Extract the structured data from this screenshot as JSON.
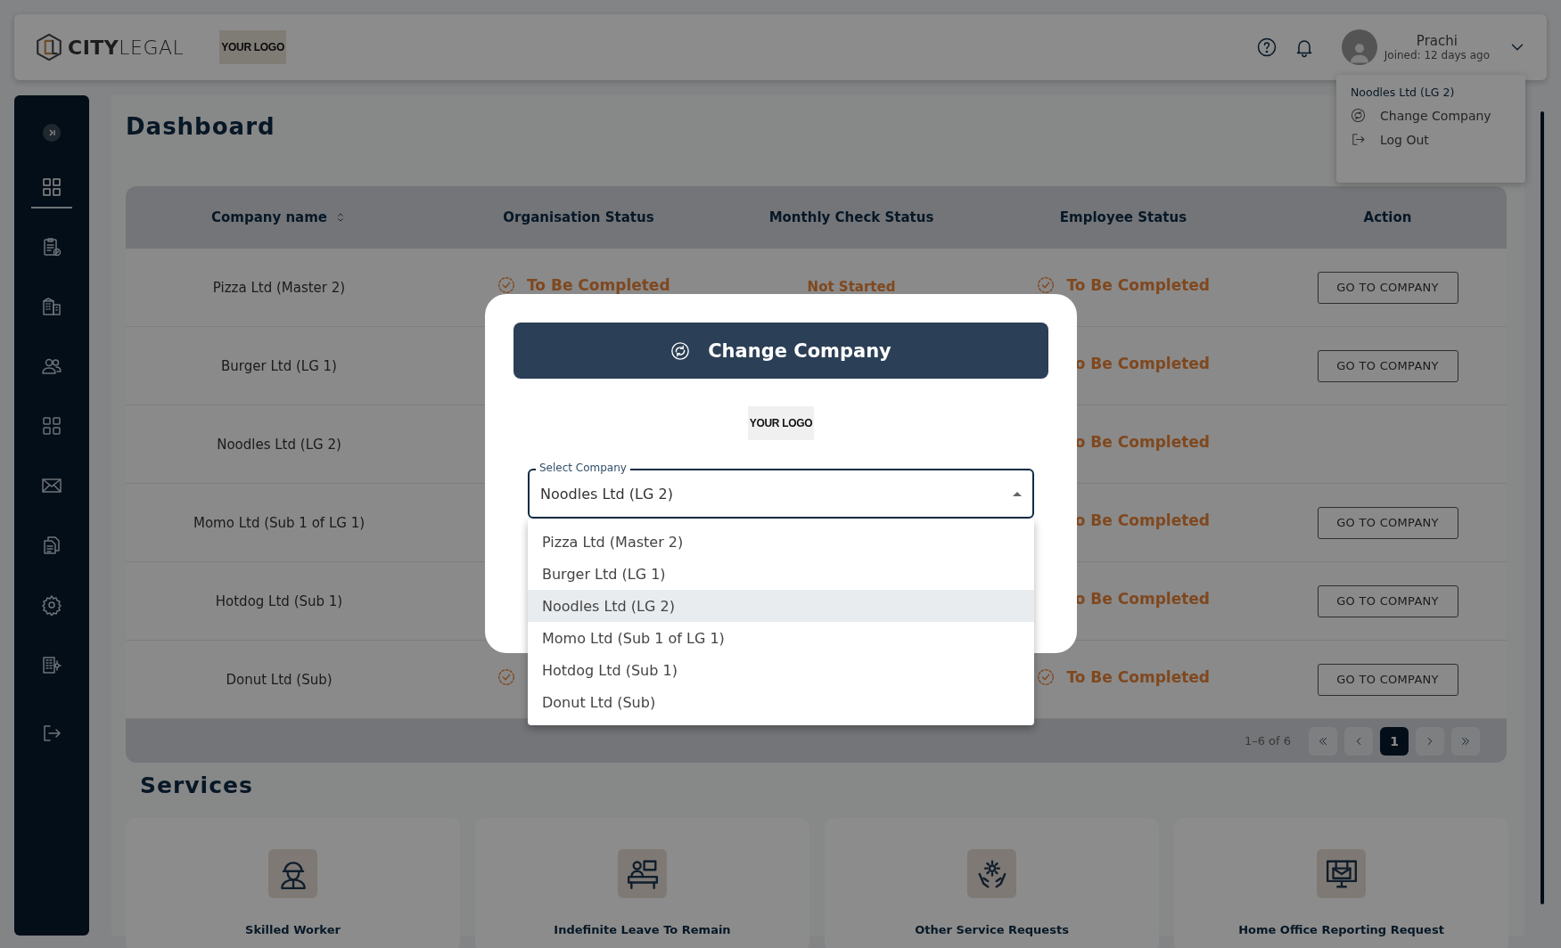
{
  "header": {
    "logo": "**CITY**LEGAL",
    "company_logo": "YOUR LOGO",
    "user": {
      "name": "Prachi",
      "joined": "Joined: 12 days ago"
    }
  },
  "user_menu": {
    "company": "Noodles Ltd (LG 2)",
    "items": [
      {
        "kind": "change",
        "label": "Change Company"
      },
      {
        "kind": "logout",
        "label": "Log Out"
      }
    ]
  },
  "sidebar": {
    "items": [
      {
        "kind": "dashboard",
        "selected": true
      },
      {
        "kind": "checklist",
        "selected": false
      },
      {
        "kind": "buildings",
        "selected": false
      },
      {
        "kind": "people",
        "selected": false
      },
      {
        "kind": "apps",
        "selected": false
      },
      {
        "kind": "mail",
        "selected": false
      },
      {
        "kind": "documents",
        "selected": false
      },
      {
        "kind": "settings",
        "selected": false
      },
      {
        "kind": "office",
        "selected": false
      },
      {
        "kind": "logout",
        "selected": false
      }
    ]
  },
  "page_title": "Dashboard",
  "table": {
    "columns": [
      {
        "label": "Company name",
        "sortable": true
      },
      {
        "label": "Organisation Status",
        "sortable": false
      },
      {
        "label": "Monthly Check Status",
        "sortable": false
      },
      {
        "label": "Employee Status",
        "sortable": false
      },
      {
        "label": "Action",
        "sortable": false
      }
    ],
    "rows": [
      {
        "name": "Pizza Ltd (Master 2)",
        "org_status": {
          "text": "To Be Completed",
          "icon": true
        },
        "monthly_status": {
          "text": "Not Started",
          "icon": false
        },
        "employee_status": {
          "text": "To Be Completed",
          "icon": true
        },
        "action": "GO TO COMPANY"
      },
      {
        "name": "Burger Ltd (LG 1)",
        "employee_status": {
          "text": "o Be Completed",
          "icon": false
        },
        "action": "GO TO COMPANY"
      },
      {
        "name": "Noodles Ltd (LG 2)",
        "employee_status": {
          "text": "o Be Completed",
          "icon": false
        }
      },
      {
        "name": "Momo Ltd (Sub 1 of LG 1)",
        "employee_status": {
          "text": "o Be Completed",
          "icon": false
        },
        "action": "GO TO COMPANY"
      },
      {
        "name": "Hotdog Ltd (Sub 1)",
        "employee_status": {
          "text": "o Be Completed",
          "icon": false
        },
        "action": "GO TO COMPANY"
      },
      {
        "name": "Donut Ltd (Sub)",
        "org_status": {
          "icon": true
        },
        "employee_status": {
          "text": "To Be Completed",
          "icon": true
        },
        "action": "GO TO COMPANY"
      }
    ]
  },
  "pagination": {
    "range": "1–6 of 6",
    "pages": [
      {
        "label": "1",
        "selected": true
      }
    ]
  },
  "services": {
    "title": "Services",
    "items": [
      {
        "kind": "worker",
        "label": "Skilled Worker"
      },
      {
        "kind": "desk",
        "label": "Indefinite Leave To Remain"
      },
      {
        "kind": "care",
        "label": "Other Service Requests"
      },
      {
        "kind": "report",
        "label": "Home Office Reporting Request"
      }
    ]
  },
  "modal": {
    "title": "Change Company",
    "logo": "YOUR LOGO",
    "field": {
      "label": "Select Company",
      "value": "Noodles Ltd (LG 2)",
      "expanded": true
    },
    "options": [
      {
        "label": "Pizza Ltd (Master 2)",
        "selected": false
      },
      {
        "label": "Burger Ltd (LG 1)",
        "selected": false
      },
      {
        "label": "Noodles Ltd (LG 2)",
        "selected": true
      },
      {
        "label": "Momo Ltd (Sub 1 of LG 1)",
        "selected": false
      },
      {
        "label": "Hotdog Ltd (Sub 1)",
        "selected": false
      },
      {
        "label": "Donut Ltd (Sub)",
        "selected": false
      }
    ]
  }
}
